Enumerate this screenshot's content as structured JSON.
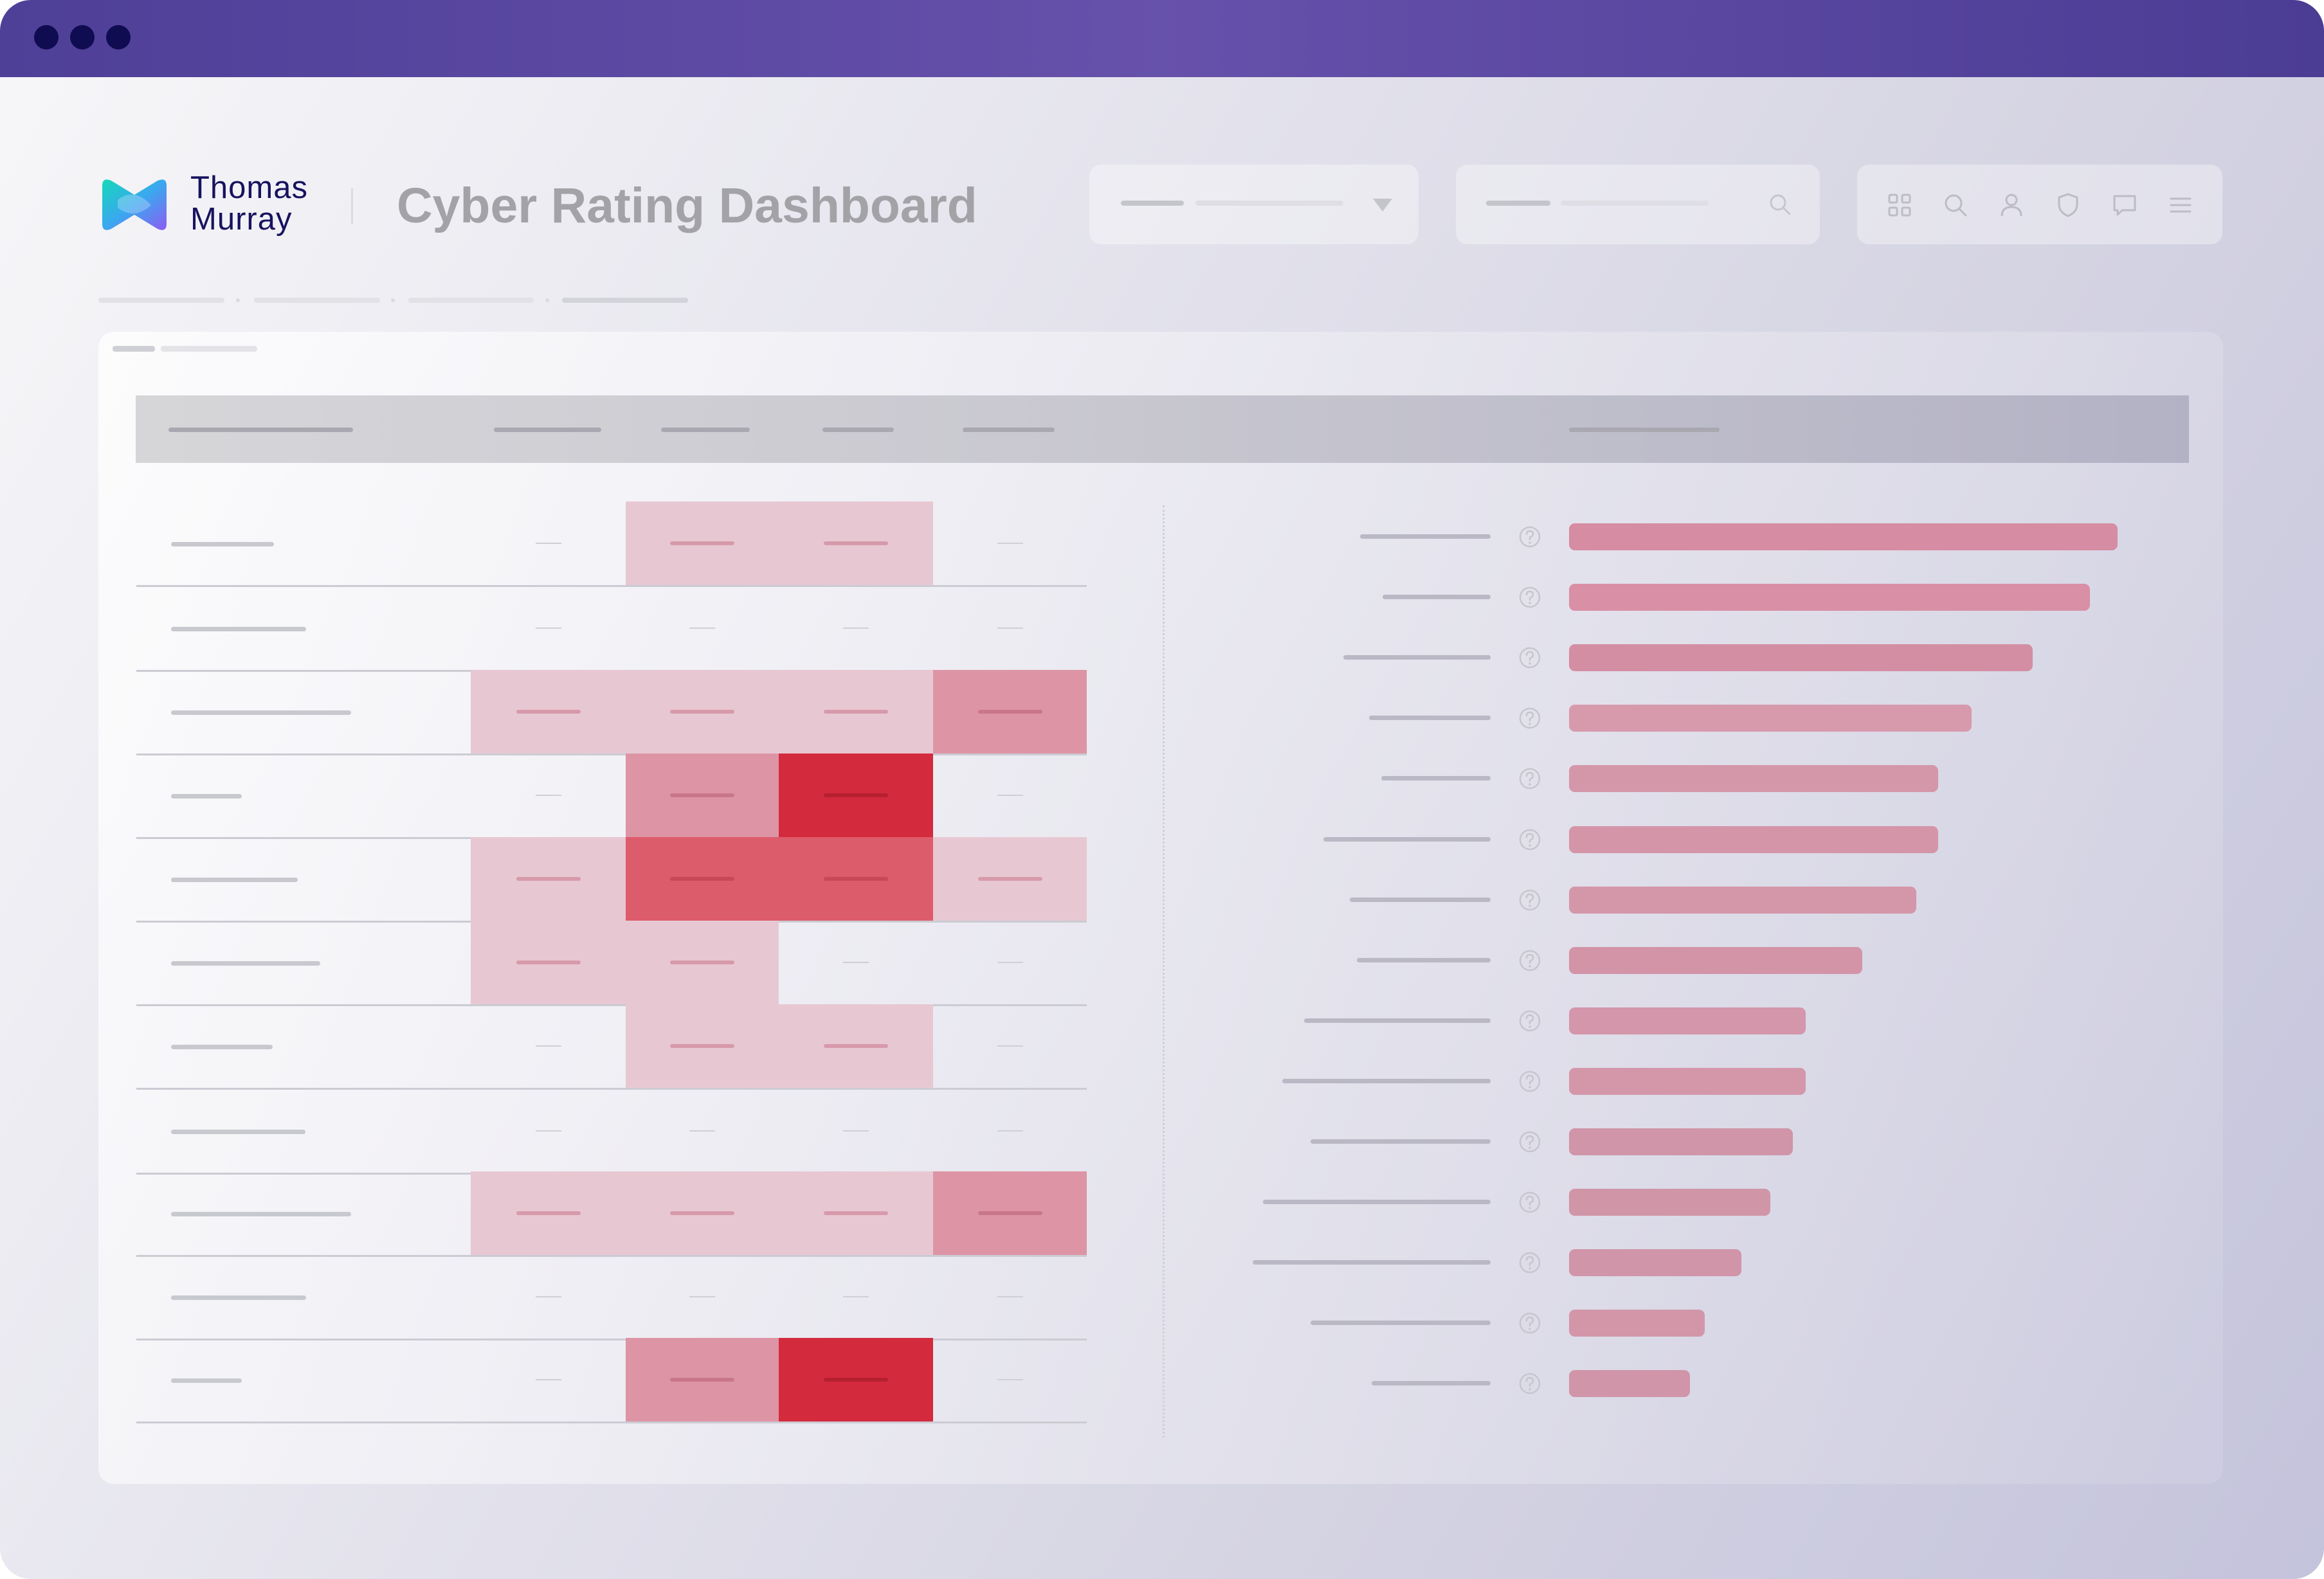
{
  "app": {
    "brand_line1": "Thomas",
    "brand_line2": "Murray",
    "title": "Cyber Rating Dashboard"
  },
  "toolbar": {
    "icons": [
      "grid-icon",
      "search-icon",
      "user-icon",
      "shield-icon",
      "chat-icon",
      "menu-icon"
    ]
  },
  "colors": {
    "titlebar": "#6651ab",
    "brand_text": "#17135f",
    "heat_high": "#d42a3d",
    "bar_fill": "#d48fa5"
  },
  "heatmap": {
    "rows": [
      [
        "none",
        "light",
        "light",
        "none"
      ],
      [
        "none",
        "none",
        "none",
        "none"
      ],
      [
        "light",
        "light",
        "light",
        "medium"
      ],
      [
        "none",
        "medium",
        "max",
        "none"
      ],
      [
        "light",
        "high",
        "high",
        "light"
      ],
      [
        "light",
        "light",
        "none",
        "none"
      ],
      [
        "none",
        "light",
        "light",
        "none"
      ],
      [
        "none",
        "none",
        "none",
        "none"
      ],
      [
        "light",
        "light",
        "light",
        "medium"
      ],
      [
        "none",
        "none",
        "none",
        "none"
      ],
      [
        "none",
        "medium",
        "max",
        "none"
      ]
    ]
  },
  "bar_chart": {
    "relative_values": [
      1.0,
      0.95,
      0.845,
      0.734,
      0.673,
      0.673,
      0.633,
      0.535,
      0.432,
      0.432,
      0.408,
      0.367,
      0.314,
      0.247,
      0.22
    ]
  }
}
